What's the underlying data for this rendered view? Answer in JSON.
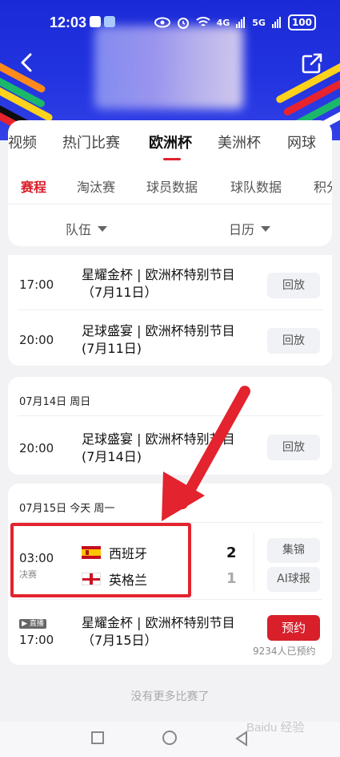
{
  "status_bar": {
    "time": "12:03",
    "signal_4g": "4G",
    "signal_5g": "5G",
    "battery": "100"
  },
  "main_tabs": [
    {
      "label": "视频"
    },
    {
      "label": "热门比赛"
    },
    {
      "label": "欧洲杯",
      "active": true
    },
    {
      "label": "美洲杯"
    },
    {
      "label": "网球"
    }
  ],
  "sub_tabs": [
    {
      "label": "赛程",
      "active": true
    },
    {
      "label": "淘汰赛"
    },
    {
      "label": "球员数据"
    },
    {
      "label": "球队数据"
    },
    {
      "label": "积分"
    }
  ],
  "filters": {
    "team": "队伍",
    "calendar": "日历"
  },
  "card1": {
    "rows": [
      {
        "time": "17:00",
        "title": "星耀金杯 | 欧洲杯特别节目（7月11日）",
        "action": "回放"
      },
      {
        "time": "20:00",
        "title": "足球盛宴 | 欧洲杯特别节目(7月11日)",
        "action": "回放"
      }
    ]
  },
  "card2": {
    "date": "07月14日 周日",
    "rows": [
      {
        "time": "20:00",
        "title": "足球盛宴 | 欧洲杯特别节目(7月14日)",
        "action": "回放"
      }
    ]
  },
  "card3": {
    "date": "07月15日 今天 周一",
    "match": {
      "time": "03:00",
      "stage": "决赛",
      "home": {
        "name": "西班牙",
        "score": "2"
      },
      "away": {
        "name": "英格兰",
        "score": "1"
      },
      "actions": [
        "集锦",
        "AI球报"
      ]
    },
    "program": {
      "live_tag": "直播",
      "time": "17:00",
      "title": "星耀金杯 | 欧洲杯特别节目（7月15日）",
      "action": "预约",
      "reserved_count": "9234人已预约"
    }
  },
  "footer": {
    "no_more": "没有更多比赛了"
  },
  "watermark": "Baidu 经验",
  "colors": {
    "brand_blue": "#2233e0",
    "accent_red": "#d81f2a"
  }
}
